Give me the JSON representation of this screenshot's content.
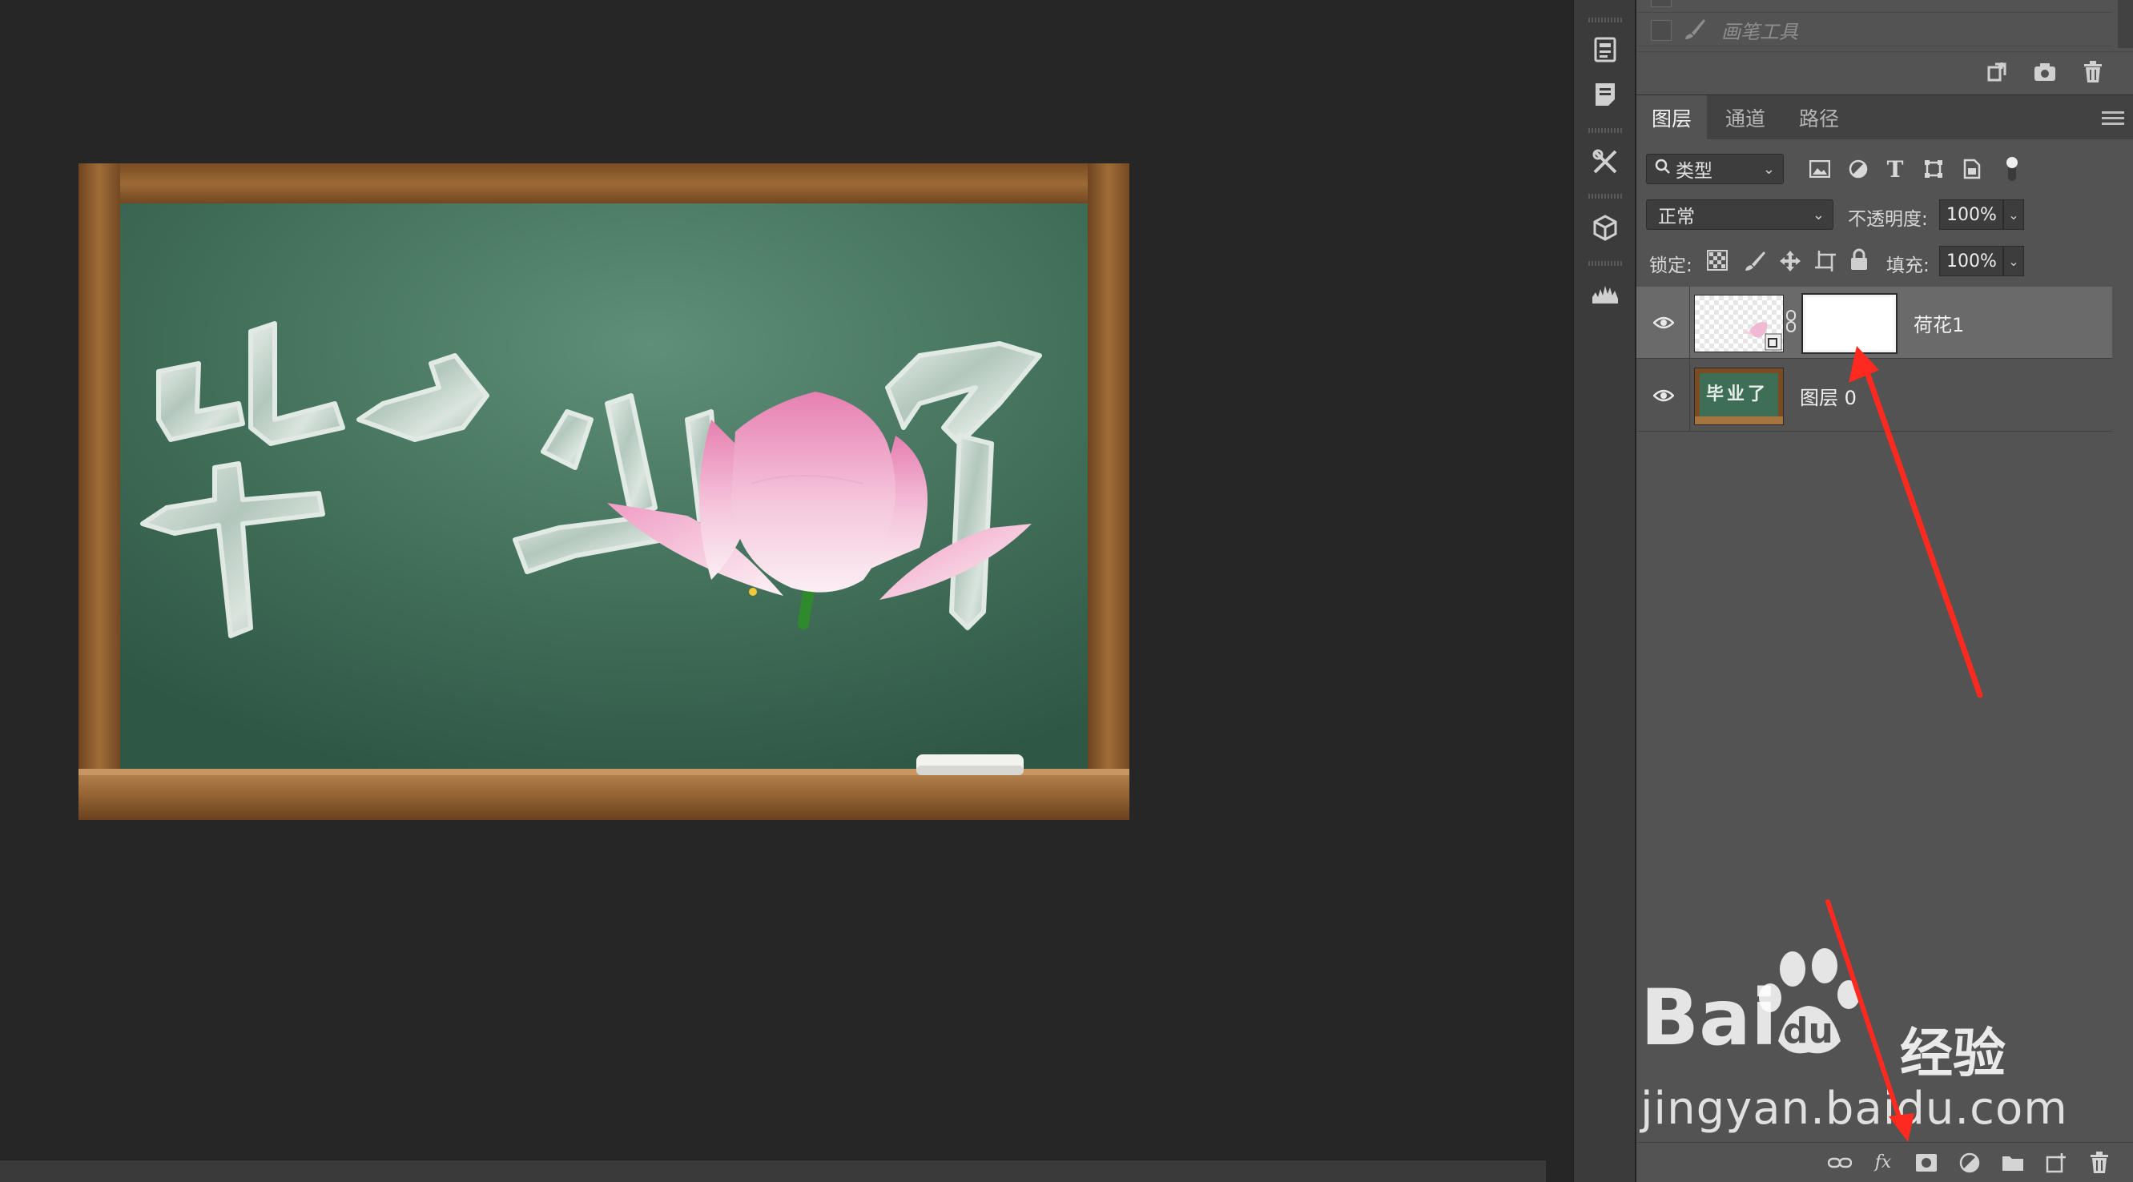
{
  "canvas": {
    "artwork_text": "毕业了"
  },
  "history": {
    "items": [
      {
        "label": "画笔工具"
      }
    ]
  },
  "layers_panel": {
    "tabs": [
      {
        "label": "图层",
        "active": true
      },
      {
        "label": "通道",
        "active": false
      },
      {
        "label": "路径",
        "active": false
      }
    ],
    "filter_kind": "类型",
    "blend_mode": "正常",
    "opacity_label": "不透明度:",
    "opacity_value": "100%",
    "lock_label": "锁定:",
    "fill_label": "填充:",
    "fill_value": "100%",
    "layers": [
      {
        "name": "荷花1",
        "selected": true,
        "visible": true,
        "has_mask": true
      },
      {
        "name": "图层 0",
        "selected": false,
        "visible": true,
        "has_mask": false
      }
    ],
    "layer0_thumb_text": "毕业了",
    "bottom_fx_label": "fx"
  },
  "watermark": {
    "brand": "Bai",
    "du": "du",
    "jingyan": "经验",
    "url": "jingyan.baidu.com"
  },
  "colors": {
    "annotation_arrow": "#ff2a1f",
    "chalkboard": "#3f6e57",
    "frame_wood": "#8a5a2c",
    "panel_bg": "#535353",
    "selected_row": "#6a6a6a"
  },
  "icons": {
    "strip": [
      "properties-icon",
      "notes-icon",
      "tools-icon",
      "3d-cube-icon",
      "histogram-icon"
    ],
    "history_toolbar": [
      "new-document-from-state-icon",
      "camera-snapshot-icon",
      "trash-icon"
    ],
    "filter": [
      "image-filter-icon",
      "adjustment-filter-icon",
      "type-filter-icon",
      "shape-filter-icon",
      "smart-object-filter-icon",
      "filter-toggle-icon"
    ],
    "lock": [
      "lock-transparent-icon",
      "lock-paint-icon",
      "lock-move-icon",
      "lock-artboard-icon",
      "lock-all-icon"
    ],
    "layers_bottom": [
      "link-layers-icon",
      "fx-icon",
      "add-mask-icon",
      "adjustment-layer-icon",
      "group-folder-icon",
      "new-layer-icon",
      "delete-layer-icon"
    ]
  }
}
